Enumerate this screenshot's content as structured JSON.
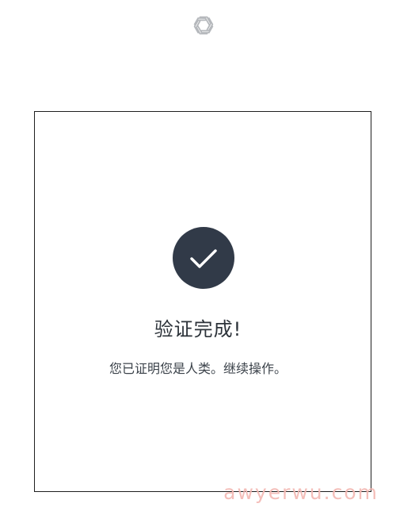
{
  "header": {
    "logo_icon": "openai-logo-icon"
  },
  "card": {
    "status_icon": "checkmark-circle-icon",
    "title": "验证完成!",
    "message": "您已证明您是人类。继续操作。"
  },
  "watermark": {
    "text": "awyerwu.com"
  },
  "colors": {
    "check_circle": "#313a48",
    "text": "#2d333a",
    "watermark": "#f3b7b2"
  }
}
